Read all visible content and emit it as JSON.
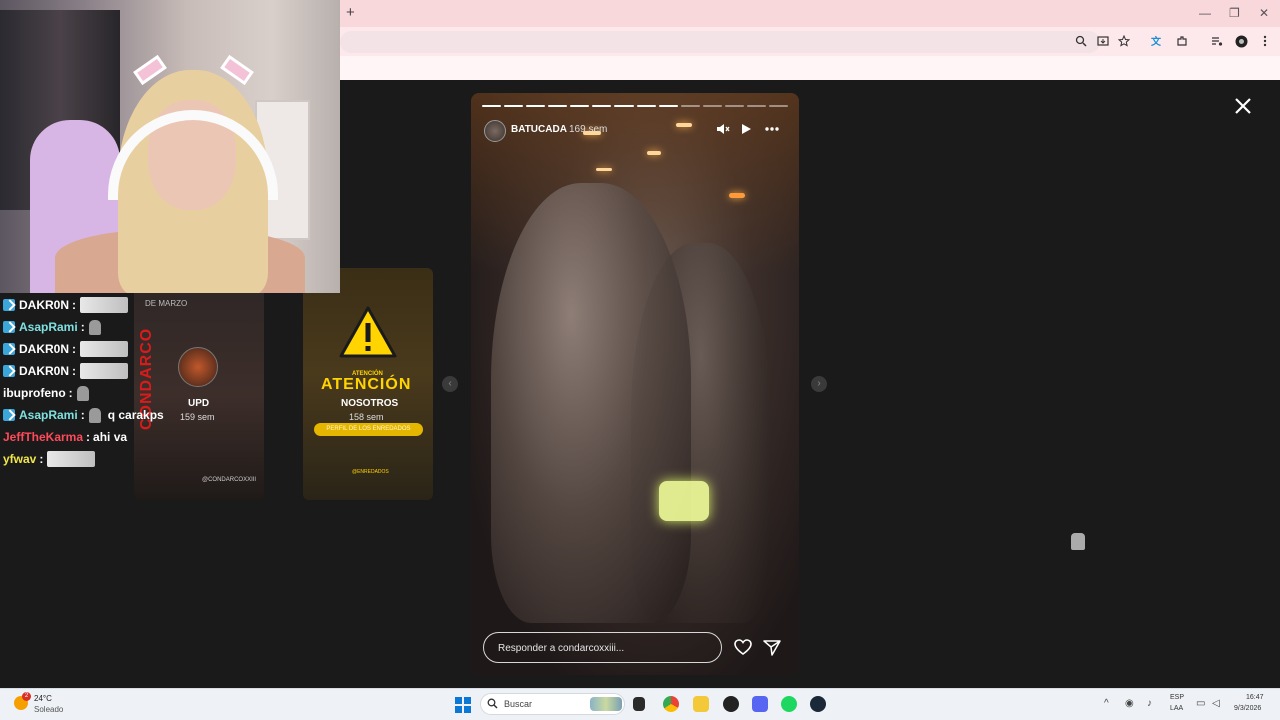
{
  "browser": {
    "new_tab_label": "+",
    "window_controls": [
      "—",
      "❐",
      "✕"
    ],
    "toolbar_icons": [
      "zoom-icon",
      "install-icon",
      "bookmark-star-icon",
      "translate-icon",
      "extensions-icon",
      "media-icon",
      "profile-icon",
      "menu-icon"
    ]
  },
  "story": {
    "username": "BATUCADA",
    "age": "169 sem",
    "segments_total": 14,
    "segments_done": 9,
    "reply_placeholder": "Responder a condarcoxxiii..."
  },
  "side_stories": [
    {
      "top_text": "DE MARZO",
      "red_text": "CONDARCO",
      "username": "UPD",
      "age": "159 sem",
      "footer": "@CONDARCOXXIII"
    },
    {
      "headline": "ATENCIÓN",
      "small_text": "ATENCIÓN",
      "username": "NOSOTROS",
      "age": "158 sem",
      "pill": "PERFIL DE LOS ENREDADOS",
      "footer": "@ENREDADOS"
    }
  ],
  "chat": [
    {
      "user": "DAKR0N",
      "color": "#ffffff",
      "badge": true,
      "msg": "",
      "emote": "wide"
    },
    {
      "user": "AsapRami",
      "color": "#7fe0e0",
      "badge": true,
      "msg": "",
      "emote": "small"
    },
    {
      "user": "DAKR0N",
      "color": "#ffffff",
      "badge": true,
      "msg": "",
      "emote": "wide"
    },
    {
      "user": "DAKR0N",
      "color": "#ffffff",
      "badge": true,
      "msg": "",
      "emote": "wide"
    },
    {
      "user": "ibuprofeno",
      "color": "#ffffff",
      "badge": false,
      "msg": "",
      "emote": "small"
    },
    {
      "user": "AsapRami",
      "color": "#7fe0e0",
      "badge": true,
      "msg": "q carakps",
      "emote": "small"
    },
    {
      "user": "JeffTheKarma",
      "color": "#ff4a5a",
      "badge": false,
      "msg": "ahi va",
      "emote": ""
    },
    {
      "user": "yfwav",
      "color": "#f0e64a",
      "badge": false,
      "msg": "",
      "emote": "wide"
    }
  ],
  "taskbar": {
    "weather_temp": "24°C",
    "weather_desc": "Soleado",
    "weather_badge": "2",
    "search_placeholder": "Buscar",
    "lang_top": "ESP",
    "lang_bottom": "LAA",
    "time": "16:47",
    "date": "9/3/2026"
  },
  "colors": {
    "viewer_bg": "#1a1a1a",
    "tabbar_bg": "#f9d8dc",
    "taskbar_bg": "#eef1f5",
    "warning_yellow": "#ffd400"
  }
}
